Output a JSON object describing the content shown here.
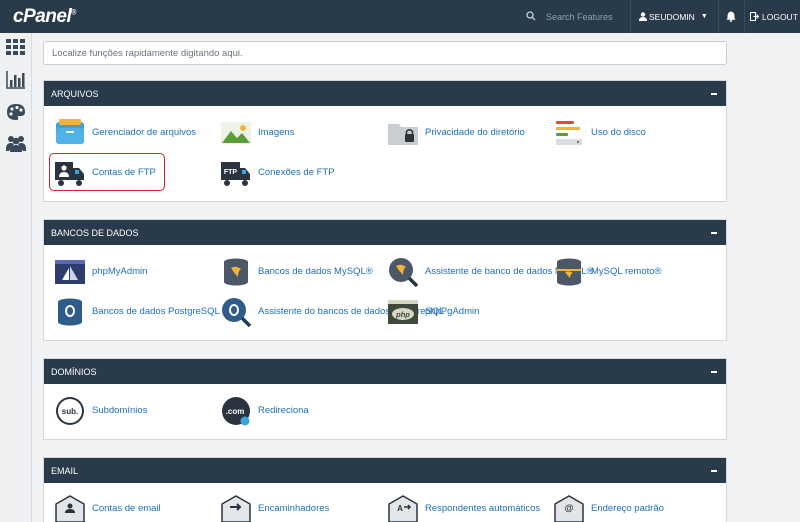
{
  "topbar": {
    "logo": "cPanel",
    "search_placeholder": "Search Features",
    "username": "SEUDOMIN",
    "logout": "LOGOUT"
  },
  "quickfind": {
    "placeholder": "Localize funções rapidamente digitando aqui."
  },
  "sections": {
    "arquivos": {
      "title": "ARQUIVOS",
      "items": [
        "Gerenciador de arquivos",
        "Imagens",
        "Privacidade do diretório",
        "Uso do disco",
        "Contas de FTP",
        "Conexões de FTP"
      ]
    },
    "bancos": {
      "title": "BANCOS DE DADOS",
      "items": [
        "phpMyAdmin",
        "Bancos de dados MySQL®",
        "Assistente de banco de dados MySQL®",
        "MySQL remoto®",
        "Bancos de dados PostgreSQL",
        "Assistente do bancos de dados PostgreSQL",
        "phpPgAdmin"
      ]
    },
    "dominios": {
      "title": "DOMÍNIOS",
      "items": [
        "Subdomínios",
        "Redireciona"
      ]
    },
    "email": {
      "title": "EMAIL",
      "items": [
        "Contas de email",
        "Encaminhadores",
        "Respondentes automáticos",
        "Endereço padrão"
      ]
    }
  },
  "icons": {
    "sub_text": "sub.",
    "com_text": ".com",
    "ftp_text": "FTP",
    "php_text": "php"
  }
}
